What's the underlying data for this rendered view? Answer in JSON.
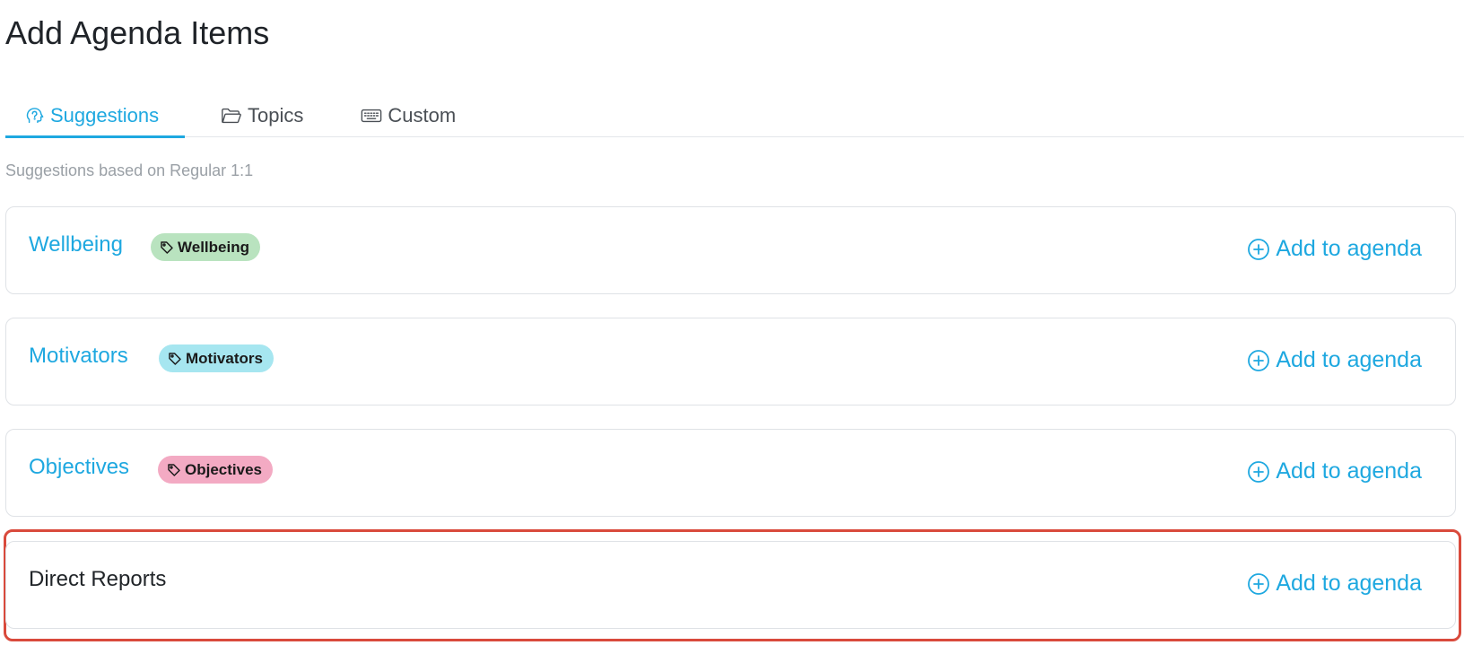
{
  "page": {
    "title": "Add Agenda Items"
  },
  "tabs": [
    {
      "label": "Suggestions",
      "icon": "brain-head-icon",
      "active": true
    },
    {
      "label": "Topics",
      "icon": "folder-icon",
      "active": false
    },
    {
      "label": "Custom",
      "icon": "keyboard-icon",
      "active": false
    }
  ],
  "subtitle": "Suggestions based on Regular 1:1",
  "colors": {
    "accent": "#1ea8e0",
    "tag_wellbeing": "#b9e3bf",
    "tag_motivators": "#a6e6f0",
    "tag_objectives": "#f3aac3",
    "highlight": "#d94a3c"
  },
  "suggestions": [
    {
      "title": "Wellbeing",
      "tag": "Wellbeing",
      "action": "Add to agenda"
    },
    {
      "title": "Motivators",
      "tag": "Motivators",
      "action": "Add to agenda"
    },
    {
      "title": "Objectives",
      "tag": "Objectives",
      "action": "Add to agenda"
    },
    {
      "title": "Direct Reports",
      "tag": "",
      "action": "Add to agenda"
    }
  ]
}
